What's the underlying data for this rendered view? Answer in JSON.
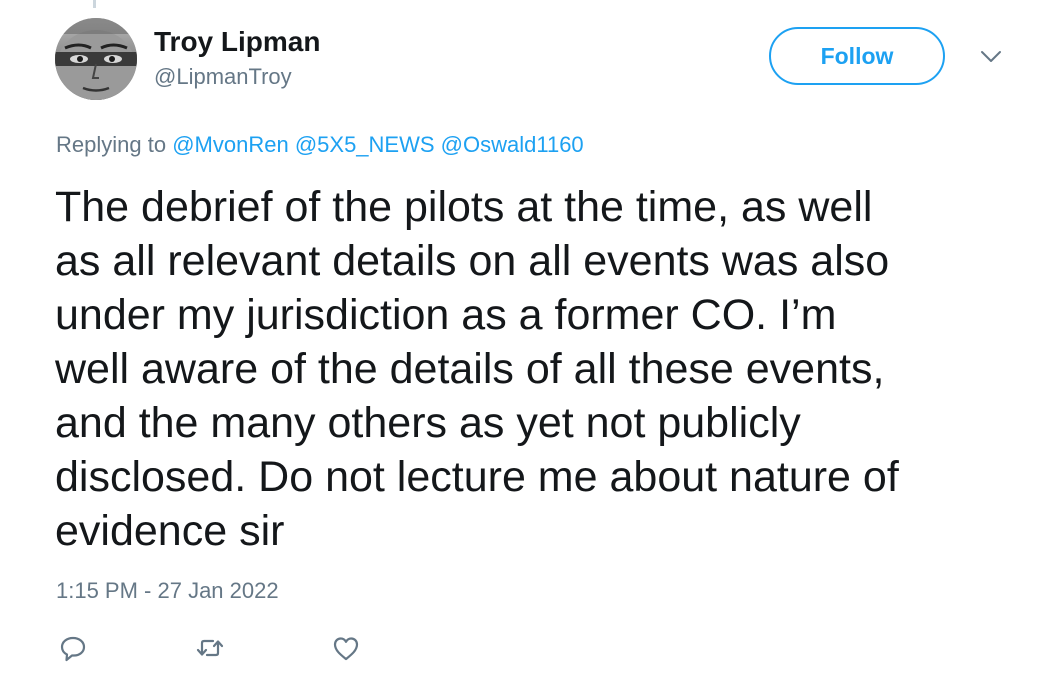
{
  "tweet": {
    "author_name": "Troy Lipman",
    "author_handle": "@LipmanTroy",
    "follow_label": "Follow",
    "replying_prefix": "Replying to",
    "reply_mentions": [
      "@MvonRen",
      "@5X5_NEWS",
      "@Oswald1160"
    ],
    "text": "The debrief of the pilots at the time, as well\nas all relevant details on all events was also\nunder my jurisdiction as a former CO. I’m\nwell aware of the details of all these events,\nand the many others as yet not publicly\ndisclosed. Do not lecture me about nature of\nevidence sir",
    "timestamp": "1:15 PM - 27 Jan 2022"
  },
  "icons": {
    "more": "chevron-down-icon",
    "reply": "reply-icon",
    "retweet": "retweet-icon",
    "like": "heart-icon"
  },
  "colors": {
    "accent": "#1da1f2",
    "text": "#14171a",
    "secondary_text": "#657786"
  }
}
